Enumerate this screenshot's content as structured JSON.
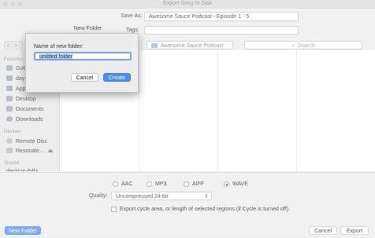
{
  "window": {
    "title": "Export Song to Disk"
  },
  "header": {
    "save_as_label": "Save As:",
    "save_as_value": "Awesome Sauce Podcast - Episode 1 - 5",
    "tags_label": "Tags:",
    "new_folder_tab": "New Folder"
  },
  "toolbar": {
    "location": "Awesome Sauce Podcast",
    "search_placeholder": "Search"
  },
  "sidebar": {
    "favorites_heading": "Favorites",
    "favorites": [
      "Gob",
      "day",
      "Applications",
      "Desktop",
      "Documents",
      "Downloads"
    ],
    "devices_heading": "Devices",
    "devices": [
      "Remote Disc",
      "Resonate..."
    ],
    "shared_heading": "Shared",
    "shared": [
      "desktop-6dla"
    ]
  },
  "formats": {
    "options": [
      "AAC",
      "MP3",
      "AIFF",
      "WAVE"
    ],
    "selected": "WAVE"
  },
  "quality": {
    "label": "Quality:",
    "value": "Uncompressed 24-bit"
  },
  "cycle_checkbox": {
    "label": "Export cycle area, or length of selected regions (if Cycle is turned off).",
    "checked": false
  },
  "buttons": {
    "new_folder": "New Folder",
    "cancel": "Cancel",
    "export": "Export"
  },
  "dialog": {
    "label": "Name of new folder:",
    "value": "untitled folder",
    "cancel": "Cancel",
    "create": "Create"
  },
  "colors": {
    "accent": "#4c8ff0"
  }
}
